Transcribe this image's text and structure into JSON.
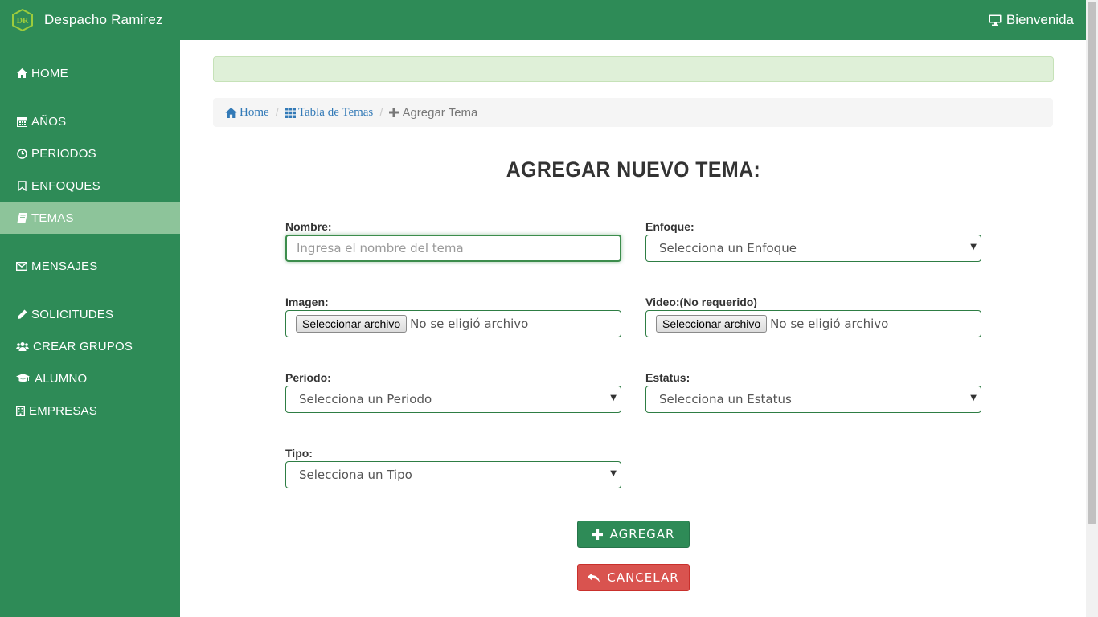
{
  "header": {
    "logo_text": "DR",
    "brand": "Despacho Ramirez",
    "welcome": "Bienvenida"
  },
  "sidebar": {
    "items": [
      {
        "label": "HOME",
        "icon": "home-icon"
      },
      {
        "label": "AÑOS",
        "icon": "calendar-icon"
      },
      {
        "label": "PERIODOS",
        "icon": "clock-icon"
      },
      {
        "label": "ENFOQUES",
        "icon": "bookmark-icon"
      },
      {
        "label": "TEMAS",
        "icon": "book-icon",
        "active": true
      },
      {
        "label": "MENSAJES",
        "icon": "envelope-icon"
      },
      {
        "label": "SOLICITUDES",
        "icon": "pencil-icon"
      },
      {
        "label": "CREAR GRUPOS",
        "icon": "users-icon"
      },
      {
        "label": "ALUMNO",
        "icon": "graduation-cap-icon"
      },
      {
        "label": "EMPRESAS",
        "icon": "building-icon"
      }
    ]
  },
  "breadcrumb": {
    "home": "Home",
    "table": "Tabla de Temas",
    "current": "Agregar Tema"
  },
  "page": {
    "title": "AGREGAR NUEVO TEMA:"
  },
  "form": {
    "nombre_label": "Nombre:",
    "nombre_placeholder": "Ingresa el nombre del tema",
    "enfoque_label": "Enfoque:",
    "enfoque_value": "Selecciona un Enfoque",
    "imagen_label": "Imagen:",
    "video_label": "Video:(No requerido)",
    "file_button": "Seleccionar archivo",
    "file_status": "No se eligió archivo",
    "periodo_label": "Periodo:",
    "periodo_value": "Selecciona un Periodo",
    "estatus_label": "Estatus:",
    "estatus_value": "Selecciona un Estatus",
    "tipo_label": "Tipo:",
    "tipo_value": "Selecciona un Tipo",
    "add_button": "AGREGAR",
    "cancel_button": "CANCELAR"
  },
  "colors": {
    "primary": "#2e8b57",
    "sidebar_active": "#8dc49a",
    "alert_bg": "#dff0d8",
    "danger": "#d9534f",
    "link": "#337ab7"
  }
}
